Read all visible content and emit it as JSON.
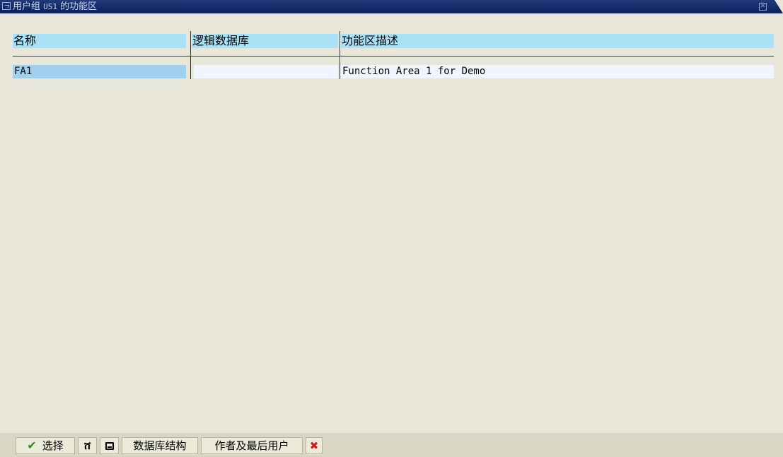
{
  "window": {
    "title_prefix": "用户组",
    "title_code": "US1",
    "title_suffix": "的功能区"
  },
  "table": {
    "columns": [
      "名称",
      "逻辑数据库",
      "功能区描述"
    ],
    "rows": [
      {
        "name": "FA1",
        "logical_db": "",
        "description": "Function Area 1 for Demo"
      }
    ]
  },
  "toolbar": {
    "select_label": "选择",
    "db_structure_label": "数据库结构",
    "author_last_user_label": "作者及最后用户"
  },
  "icons": {
    "confirm": "check-icon",
    "find": "binoculars-icon",
    "print": "printer-icon",
    "cancel": "cancel-icon",
    "window": "window-icon",
    "close": "close-icon"
  },
  "colors": {
    "title_bar": "#0b1f5c",
    "header_fill": "#a9e2f6",
    "selected_cell": "#9fd0ee",
    "row_fill": "#f2f5ff",
    "background": "#e8e6d8",
    "check": "#2f8a1d",
    "cancel": "#d01a1a"
  }
}
